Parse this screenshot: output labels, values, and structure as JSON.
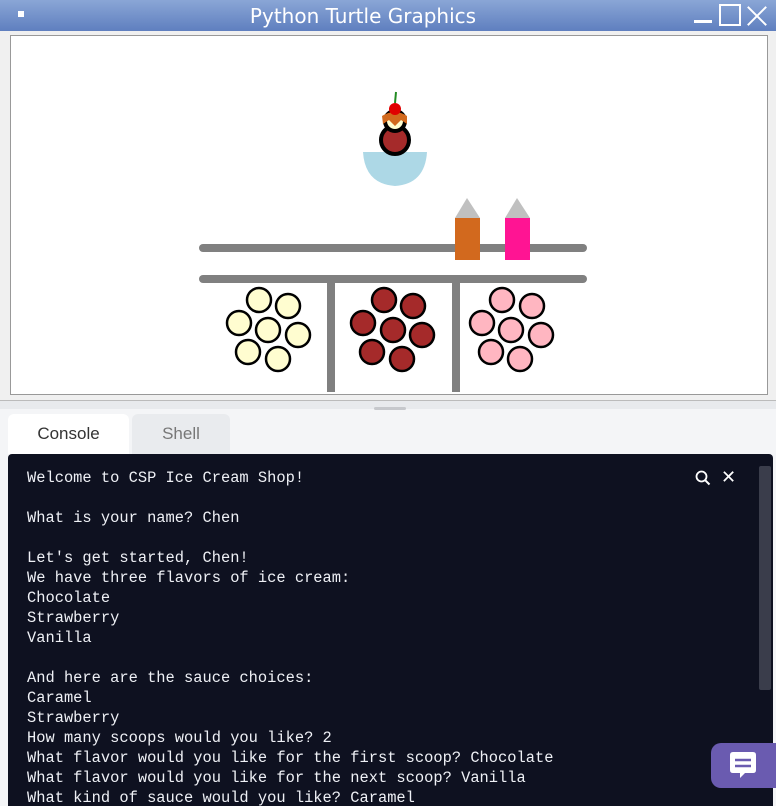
{
  "window": {
    "title": "Python Turtle Graphics"
  },
  "tabs": [
    {
      "label": "Console"
    },
    {
      "label": "Shell"
    }
  ],
  "console": {
    "text": "Welcome to CSP Ice Cream Shop!\n\nWhat is your name? Chen\n\nLet's get started, Chen!\nWe have three flavors of ice cream:\nChocolate\nStrawberry\nVanilla\n\nAnd here are the sauce choices:\nCaramel\nStrawberry\nHow many scoops would you like? 2\nWhat flavor would you like for the first scoop? Chocolate\nWhat flavor would you like for the next scoop? Vanilla\nWhat kind of sauce would you like? Caramel"
  },
  "icons": {
    "search": "search-icon",
    "close": "close-icon",
    "chat": "chat-icon",
    "window_icon": "window-menu-icon"
  },
  "colors": {
    "chocolate": "#a52a2a",
    "vanilla": "#fffdd0",
    "strawberry": "#ffb6c1",
    "caramel_bottle": "#d2691e",
    "strawberry_bottle": "#ff1493",
    "bowl": "#add8e6",
    "shelf": "#808080",
    "console_bg": "#0e1120",
    "chat_button": "#6a5bb0"
  }
}
